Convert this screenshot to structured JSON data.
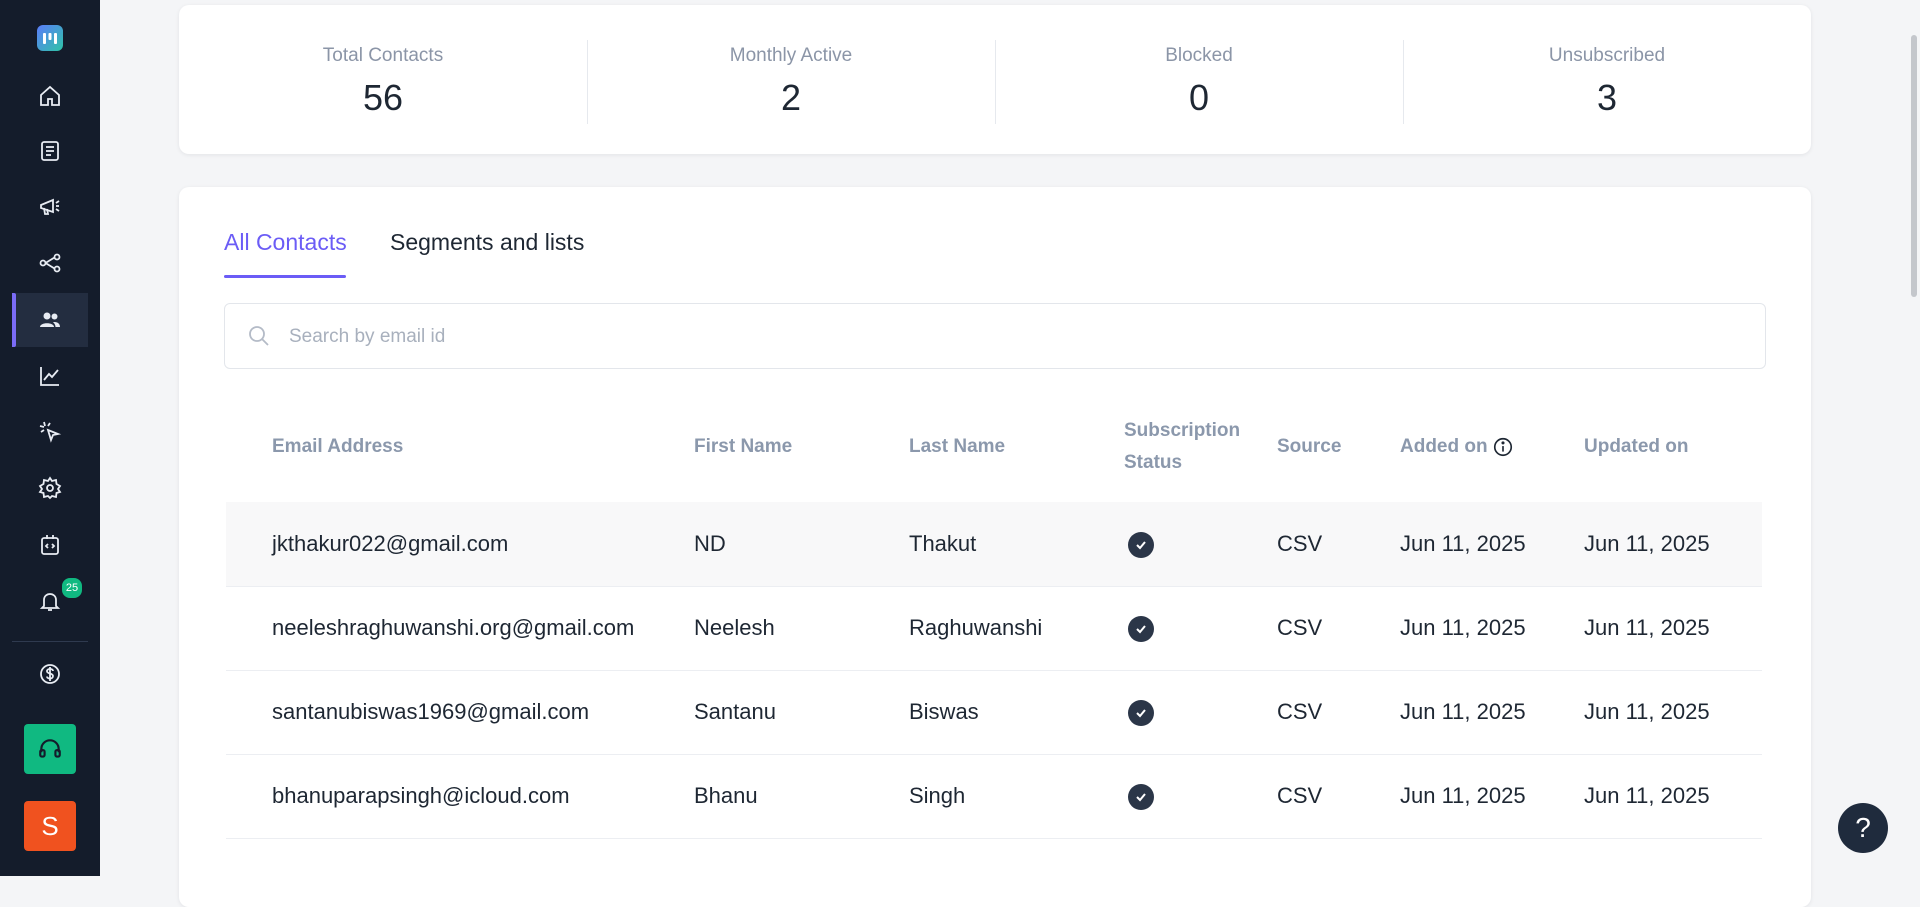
{
  "sidebar": {
    "items": [
      {
        "name": "home-icon"
      },
      {
        "name": "forms-icon"
      },
      {
        "name": "campaigns-icon"
      },
      {
        "name": "automation-icon"
      },
      {
        "name": "contacts-icon",
        "active": true
      },
      {
        "name": "analytics-icon"
      },
      {
        "name": "tracking-icon"
      },
      {
        "name": "settings-icon"
      },
      {
        "name": "integrations-icon"
      },
      {
        "name": "notifications-icon",
        "badge": "25"
      }
    ],
    "billing_icon": "dollar-icon",
    "support_icon": "headphones-icon",
    "avatar_initial": "S"
  },
  "stats": [
    {
      "label": "Total Contacts",
      "value": "56"
    },
    {
      "label": "Monthly Active",
      "value": "2"
    },
    {
      "label": "Blocked",
      "value": "0"
    },
    {
      "label": "Unsubscribed",
      "value": "3"
    }
  ],
  "tabs": [
    {
      "label": "All Contacts",
      "active": true
    },
    {
      "label": "Segments and lists",
      "active": false
    }
  ],
  "search": {
    "placeholder": "Search by email id",
    "value": ""
  },
  "table": {
    "headers": {
      "email": "Email Address",
      "first_name": "First Name",
      "last_name": "Last Name",
      "subscription_line1": "Subscription",
      "subscription_line2": "Status",
      "source": "Source",
      "added_on": "Added on",
      "updated_on": "Updated on"
    },
    "rows": [
      {
        "email": "jkthakur022@gmail.com",
        "first_name": "ND",
        "last_name": "Thakut",
        "subscribed": true,
        "source": "CSV",
        "added_on": "Jun 11, 2025",
        "updated_on": "Jun 11, 2025"
      },
      {
        "email": "neeleshraghuwanshi.org@gmail.com",
        "first_name": "Neelesh",
        "last_name": "Raghuwanshi",
        "subscribed": true,
        "source": "CSV",
        "added_on": "Jun 11, 2025",
        "updated_on": "Jun 11, 2025"
      },
      {
        "email": "santanubiswas1969@gmail.com",
        "first_name": "Santanu",
        "last_name": "Biswas",
        "subscribed": true,
        "source": "CSV",
        "added_on": "Jun 11, 2025",
        "updated_on": "Jun 11, 2025"
      },
      {
        "email": "bhanuparapsingh@icloud.com",
        "first_name": "Bhanu",
        "last_name": "Singh",
        "subscribed": true,
        "source": "CSV",
        "added_on": "Jun 11, 2025",
        "updated_on": "Jun 11, 2025"
      }
    ]
  },
  "help_label": "?",
  "colors": {
    "accent": "#6b5cf6",
    "sidebar": "#141c2b",
    "success": "#10b981",
    "avatar": "#f0521f"
  }
}
